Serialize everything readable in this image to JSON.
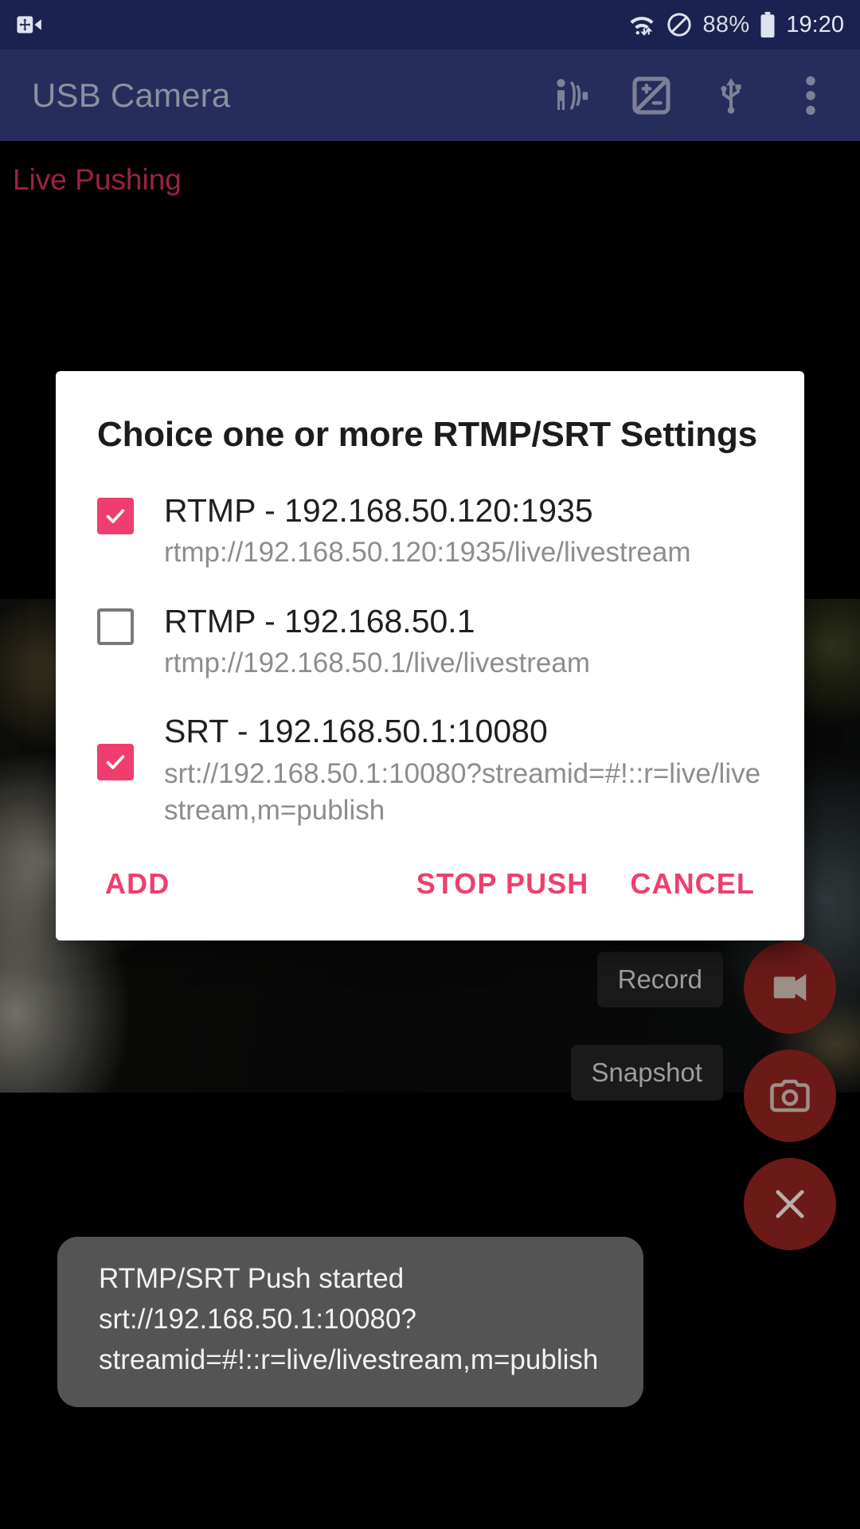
{
  "status_bar": {
    "icons": [
      "screen-record-icon",
      "wifi-icon",
      "do-not-disturb-icon",
      "battery-icon"
    ],
    "battery_percent": "88%",
    "clock": "19:20",
    "background_color": "#1b2150",
    "text_color": "#d8dae6"
  },
  "app_bar": {
    "title": "USB Camera",
    "background_color": "#262c5c",
    "title_color": "#8c8f9e",
    "actions": [
      {
        "name": "audio-source-icon",
        "label": "Audio Source"
      },
      {
        "name": "exposure-icon",
        "label": "Exposure"
      },
      {
        "name": "usb-icon",
        "label": "USB"
      },
      {
        "name": "overflow-menu-icon",
        "label": "More options"
      }
    ]
  },
  "preview": {
    "live_label": "Live Pushing",
    "live_label_color": "#9c2244",
    "record_chip": "Record",
    "snapshot_chip": "Snapshot",
    "fabs": [
      {
        "name": "record-video-fab",
        "icon": "video-camera-icon"
      },
      {
        "name": "snapshot-fab",
        "icon": "camera-icon"
      },
      {
        "name": "close-fab",
        "icon": "close-icon"
      }
    ],
    "fab_color": "#6b1a17"
  },
  "dialog": {
    "title": "Choice one or more RTMP/SRT Settings",
    "accent_color": "#ef3e6d",
    "background_color": "#ffffff",
    "options": [
      {
        "title": "RTMP - 192.168.50.120:1935",
        "url": "rtmp://192.168.50.120:1935/live/livestream",
        "checked": true
      },
      {
        "title": "RTMP - 192.168.50.1",
        "url": "rtmp://192.168.50.1/live/livestream",
        "checked": false
      },
      {
        "title": "SRT - 192.168.50.1:10080",
        "url": "srt://192.168.50.1:10080?streamid=#!::r=live/livestream,m=publish",
        "checked": true
      }
    ],
    "buttons": {
      "add": "ADD",
      "stop_push": "STOP PUSH",
      "cancel": "CANCEL"
    }
  },
  "toast": {
    "message": "RTMP/SRT Push started srt://192.168.50.1:10080?streamid=#!::r=live/livestream,m=publish",
    "background_color": "#5a5a5a",
    "text_color": "#f2f2f2"
  }
}
